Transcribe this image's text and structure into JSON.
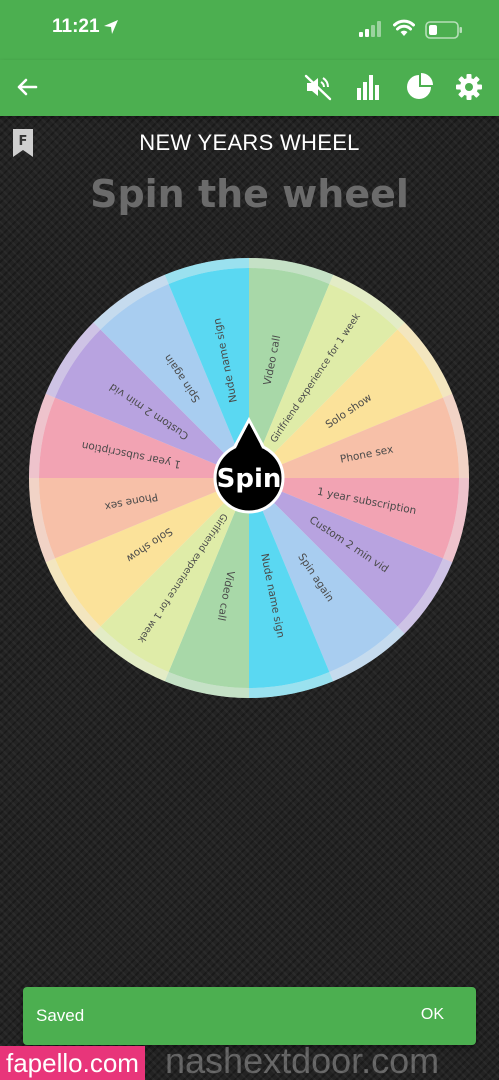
{
  "status_bar": {
    "time": "11:21"
  },
  "app_bar": {
    "icons": [
      "back-arrow-icon",
      "mute-icon",
      "stats-icon",
      "pie-chart-icon",
      "gear-icon"
    ]
  },
  "badge": {
    "letter": "F"
  },
  "wheel": {
    "title": "NEW YEARS WHEEL",
    "subtitle": "Spin the wheel",
    "spin_label": "Spin",
    "segments": [
      {
        "label": "Video call",
        "color": "#a8d8a8"
      },
      {
        "label": "Girlfriend experience for 1 week",
        "color": "#dfeca8"
      },
      {
        "label": "Solo show",
        "color": "#fbe29a"
      },
      {
        "label": "Phone sex",
        "color": "#f7c0a8"
      },
      {
        "label": "1 year subscription",
        "color": "#f2a3b3"
      },
      {
        "label": "Custom 2 min vid",
        "color": "#b8a3e0"
      },
      {
        "label": "Spin again",
        "color": "#a8cdf0"
      },
      {
        "label": "Nude name sign",
        "color": "#5ad8f2"
      },
      {
        "label": "Video call",
        "color": "#a8d8a8"
      },
      {
        "label": "Girlfriend experience for 1 week",
        "color": "#dfeca8"
      },
      {
        "label": "Solo show",
        "color": "#fbe29a"
      },
      {
        "label": "Phone sex",
        "color": "#f7c0a8"
      },
      {
        "label": "1 year subscription",
        "color": "#f2a3b3"
      },
      {
        "label": "Custom 2 min vid",
        "color": "#b8a3e0"
      },
      {
        "label": "Spin again",
        "color": "#a8cdf0"
      },
      {
        "label": "Nude name sign",
        "color": "#5ad8f2"
      }
    ]
  },
  "snackbar": {
    "message": "Saved",
    "action": "OK"
  },
  "watermark": {
    "left": "fapello.com",
    "right": "nashextdoor.com"
  },
  "colors": {
    "accent": "#4caf50",
    "background": "#232323",
    "subtitle": "#6b6b6b"
  }
}
